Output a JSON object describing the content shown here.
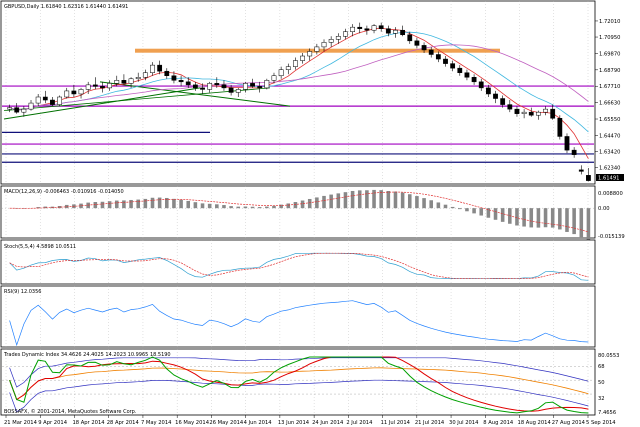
{
  "colors": {
    "background": "#ffffff",
    "frame": "#000000",
    "grid": "#b8b8b8",
    "bull": "#ffffff",
    "bear": "#000000",
    "wick": "#000000",
    "ma_fast": "#e03030",
    "ma_slow": "#40b8e0",
    "ma_long": "#c060c0",
    "support_purple": "#a000c0",
    "support_navy": "#10107a",
    "zone_orange": "#f0a050",
    "trend_green": "#007000",
    "macd_signal": "#e03030",
    "rsi_line": "#2080ff",
    "tdi_blue": "#3030c0",
    "tdi_green": "#00a000",
    "tdi_red": "#e00000",
    "tdi_orange": "#f08000",
    "current_price_bg": "#000000"
  },
  "main": {
    "header": "GBPUSD,Daily  1.61840  1.62316  1.61440  1.61491",
    "current_price": "1.61491",
    "price_labels": [
      "1.72010",
      "1.70950",
      "1.69870",
      "1.68790",
      "1.67710",
      "1.66630",
      "1.65550",
      "1.64470",
      "1.63420",
      "1.62340"
    ]
  },
  "macd": {
    "header": "MACD(12,26,9) -0.006463 -0.010916 -0.014050",
    "labels": [
      "0.008800",
      "0.00",
      "-0.015139"
    ]
  },
  "stoch": {
    "header": "Stoch(5,5,4) 4.5898 10.0511"
  },
  "rsi": {
    "header": "RSI(9) 12.0356"
  },
  "tdi": {
    "header": "Trades Dynamic Index 34.4626 24.4025 14.2023 10.9965 18.5190",
    "labels": [
      "80.0553",
      "68",
      "50",
      "32",
      "7.4656"
    ],
    "copyright": "BOSSAFX, © 2001-2014, MetaQuotes Software Corp."
  },
  "x_axis": {
    "labels": [
      "21 Mar 2014",
      "9 Apr 2014",
      "18 Apr 2014",
      "28 Apr 2014",
      "7 May 2014",
      "16 May 2014",
      "26 May 2014",
      "4 Jun 2014",
      "13 Jun 2014",
      "24 Jun 2014",
      "2 Jul 2014",
      "11 Jul 2014",
      "21 Jul 2014",
      "30 Jul 2014",
      "8 Aug 2014",
      "18 Aug 2014",
      "27 Aug 2014",
      "5 Sep 2014"
    ]
  },
  "chart_data": {
    "type": "candlestick",
    "symbol": "GBPUSD",
    "timeframe": "Daily",
    "ylim": [
      1.614,
      1.726
    ],
    "candles": [
      [
        1.662,
        1.665,
        1.66,
        1.663
      ],
      [
        1.663,
        1.666,
        1.659,
        1.66
      ],
      [
        1.66,
        1.664,
        1.657,
        1.662
      ],
      [
        1.662,
        1.668,
        1.661,
        1.666
      ],
      [
        1.666,
        1.672,
        1.664,
        1.67
      ],
      [
        1.67,
        1.674,
        1.666,
        1.668
      ],
      [
        1.668,
        1.67,
        1.664,
        1.665
      ],
      [
        1.665,
        1.671,
        1.664,
        1.67
      ],
      [
        1.67,
        1.676,
        1.669,
        1.674
      ],
      [
        1.674,
        1.678,
        1.67,
        1.672
      ],
      [
        1.672,
        1.676,
        1.669,
        1.675
      ],
      [
        1.675,
        1.68,
        1.672,
        1.678
      ],
      [
        1.678,
        1.683,
        1.675,
        1.677
      ],
      [
        1.677,
        1.68,
        1.673,
        1.676
      ],
      [
        1.676,
        1.681,
        1.674,
        1.679
      ],
      [
        1.679,
        1.684,
        1.677,
        1.681
      ],
      [
        1.681,
        1.685,
        1.678,
        1.679
      ],
      [
        1.679,
        1.683,
        1.676,
        1.682
      ],
      [
        1.682,
        1.686,
        1.68,
        1.683
      ],
      [
        1.683,
        1.688,
        1.681,
        1.686
      ],
      [
        1.686,
        1.693,
        1.684,
        1.691
      ],
      [
        1.691,
        1.694,
        1.685,
        1.687
      ],
      [
        1.687,
        1.689,
        1.682,
        1.684
      ],
      [
        1.684,
        1.687,
        1.679,
        1.681
      ],
      [
        1.681,
        1.684,
        1.677,
        1.68
      ],
      [
        1.68,
        1.683,
        1.676,
        1.678
      ],
      [
        1.678,
        1.68,
        1.674,
        1.676
      ],
      [
        1.676,
        1.679,
        1.672,
        1.675
      ],
      [
        1.675,
        1.68,
        1.673,
        1.679
      ],
      [
        1.679,
        1.683,
        1.676,
        1.678
      ],
      [
        1.678,
        1.681,
        1.674,
        1.676
      ],
      [
        1.676,
        1.678,
        1.671,
        1.673
      ],
      [
        1.673,
        1.676,
        1.67,
        1.675
      ],
      [
        1.675,
        1.68,
        1.673,
        1.679
      ],
      [
        1.679,
        1.682,
        1.676,
        1.677
      ],
      [
        1.677,
        1.68,
        1.673,
        1.676
      ],
      [
        1.676,
        1.682,
        1.675,
        1.681
      ],
      [
        1.681,
        1.686,
        1.679,
        1.684
      ],
      [
        1.684,
        1.69,
        1.682,
        1.688
      ],
      [
        1.688,
        1.692,
        1.685,
        1.69
      ],
      [
        1.69,
        1.696,
        1.688,
        1.694
      ],
      [
        1.694,
        1.699,
        1.692,
        1.697
      ],
      [
        1.697,
        1.702,
        1.694,
        1.7
      ],
      [
        1.7,
        1.705,
        1.698,
        1.703
      ],
      [
        1.703,
        1.708,
        1.7,
        1.706
      ],
      [
        1.706,
        1.71,
        1.703,
        1.708
      ],
      [
        1.708,
        1.712,
        1.705,
        1.71
      ],
      [
        1.71,
        1.715,
        1.708,
        1.713
      ],
      [
        1.713,
        1.718,
        1.71,
        1.716
      ],
      [
        1.716,
        1.719,
        1.712,
        1.715
      ],
      [
        1.715,
        1.717,
        1.711,
        1.714
      ],
      [
        1.714,
        1.718,
        1.712,
        1.717
      ],
      [
        1.717,
        1.719,
        1.713,
        1.715
      ],
      [
        1.715,
        1.717,
        1.71,
        1.712
      ],
      [
        1.712,
        1.716,
        1.709,
        1.714
      ],
      [
        1.714,
        1.717,
        1.71,
        1.711
      ],
      [
        1.711,
        1.713,
        1.705,
        1.707
      ],
      [
        1.707,
        1.709,
        1.702,
        1.704
      ],
      [
        1.704,
        1.706,
        1.699,
        1.701
      ],
      [
        1.701,
        1.703,
        1.696,
        1.698
      ],
      [
        1.698,
        1.7,
        1.693,
        1.695
      ],
      [
        1.695,
        1.697,
        1.69,
        1.692
      ],
      [
        1.692,
        1.694,
        1.687,
        1.689
      ],
      [
        1.689,
        1.691,
        1.684,
        1.686
      ],
      [
        1.686,
        1.688,
        1.681,
        1.683
      ],
      [
        1.683,
        1.685,
        1.678,
        1.68
      ],
      [
        1.68,
        1.682,
        1.674,
        1.676
      ],
      [
        1.676,
        1.678,
        1.67,
        1.672
      ],
      [
        1.672,
        1.674,
        1.666,
        1.669
      ],
      [
        1.669,
        1.671,
        1.663,
        1.665
      ],
      [
        1.665,
        1.668,
        1.66,
        1.662
      ],
      [
        1.662,
        1.664,
        1.657,
        1.659
      ],
      [
        1.659,
        1.662,
        1.656,
        1.66
      ],
      [
        1.66,
        1.663,
        1.657,
        1.658
      ],
      [
        1.658,
        1.661,
        1.655,
        1.66
      ],
      [
        1.66,
        1.664,
        1.658,
        1.662
      ],
      [
        1.662,
        1.665,
        1.655,
        1.656
      ],
      [
        1.656,
        1.658,
        1.642,
        1.644
      ],
      [
        1.644,
        1.646,
        1.633,
        1.635
      ],
      [
        1.635,
        1.637,
        1.63,
        1.632
      ],
      [
        1.622,
        1.625,
        1.619,
        1.621
      ],
      [
        1.6184,
        1.6232,
        1.6144,
        1.6149
      ]
    ],
    "horizontal_levels": [
      1.6772,
      1.664,
      1.6467,
      1.639,
      1.6325
    ],
    "resistance_zone": [
      1.699,
      1.7005
    ],
    "macd_range": [
      -0.015139,
      0.0088
    ],
    "stoch_range": [
      0,
      100
    ],
    "rsi_range": [
      0,
      100
    ],
    "tdi_range": [
      7.4656,
      80.0553
    ],
    "tdi_levels": [
      68,
      50,
      32
    ]
  }
}
